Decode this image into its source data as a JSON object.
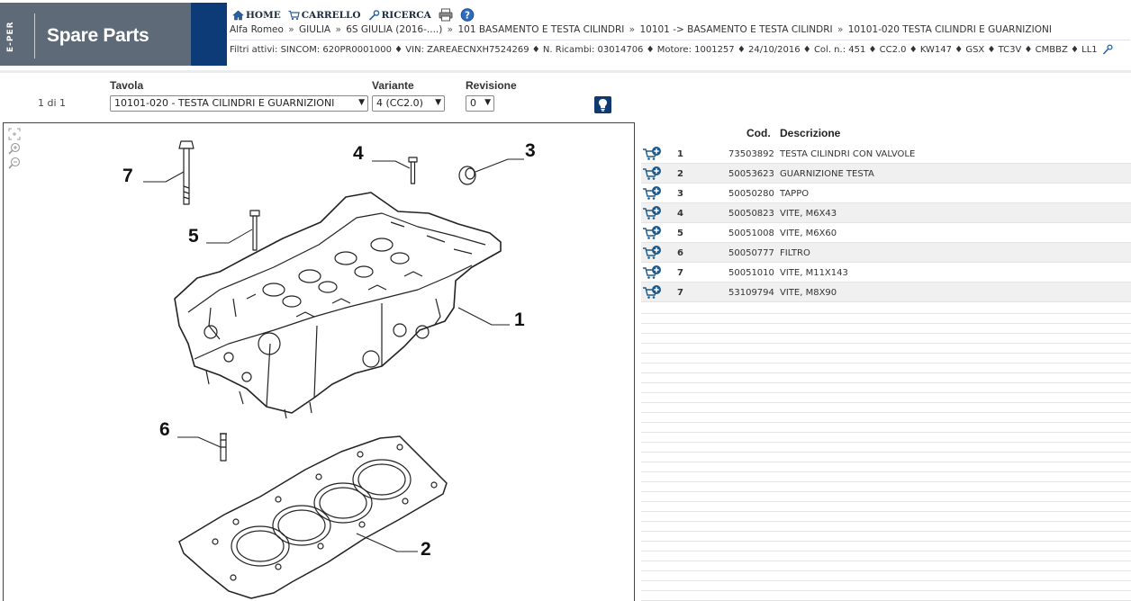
{
  "brand": {
    "vertical_logo": "E-PER",
    "title": "Spare Parts"
  },
  "nav": {
    "home": "HOME",
    "cart": "CARRELLO",
    "search": "RICERCA"
  },
  "breadcrumb": [
    "Alfa Romeo",
    "GIULIA",
    "6S GIULIA (2016-....)",
    "101 BASAMENTO E TESTA CILINDRI",
    "10101 -> BASAMENTO E TESTA CILINDRI",
    "10101-020 TESTA CILINDRI E GUARNIZIONI"
  ],
  "filters": {
    "text": "Filtri attivi: SINCOM: 620PR0001000 ♦ VIN: ZAREAECNXH7524269 ♦ N. Ricambi: 03014706 ♦ Motore: 1001257 ♦ 24/10/2016 ♦ Col. n.: 451 ♦ CC2.0 ♦ KW147 ♦ GSX ♦ TC3V ♦ CMBBZ ♦ LL1"
  },
  "selection": {
    "pager": "1 di 1",
    "tavola_label": "Tavola",
    "tavola_value": "10101-020 - TESTA CILINDRI E GUARNIZIONI",
    "variante_label": "Variante",
    "variante_value": "4 (CC2.0)",
    "revisione_label": "Revisione",
    "revisione_value": "0"
  },
  "diagram": {
    "callouts": [
      "1",
      "2",
      "3",
      "4",
      "5",
      "6",
      "7"
    ]
  },
  "parts": {
    "header_code": "Cod.",
    "header_desc": "Descrizione",
    "rows": [
      {
        "idx": "1",
        "code": "73503892",
        "desc": "TESTA CILINDRI CON VALVOLE"
      },
      {
        "idx": "2",
        "code": "50053623",
        "desc": "GUARNIZIONE TESTA"
      },
      {
        "idx": "3",
        "code": "50050280",
        "desc": "TAPPO"
      },
      {
        "idx": "4",
        "code": "50050823",
        "desc": "VITE, M6X43"
      },
      {
        "idx": "5",
        "code": "50051008",
        "desc": "VITE, M6X60"
      },
      {
        "idx": "6",
        "code": "50050777",
        "desc": "FILTRO"
      },
      {
        "idx": "7",
        "code": "50051010",
        "desc": "VITE, M11X143"
      },
      {
        "idx": "7",
        "code": "53109794",
        "desc": "VITE, M8X90"
      }
    ]
  },
  "colors": {
    "brand_gray": "#5f6a78",
    "brand_blue": "#0d3b78",
    "cart_icon": "#1e5a8a",
    "row_alt": "#f0f0f0"
  }
}
